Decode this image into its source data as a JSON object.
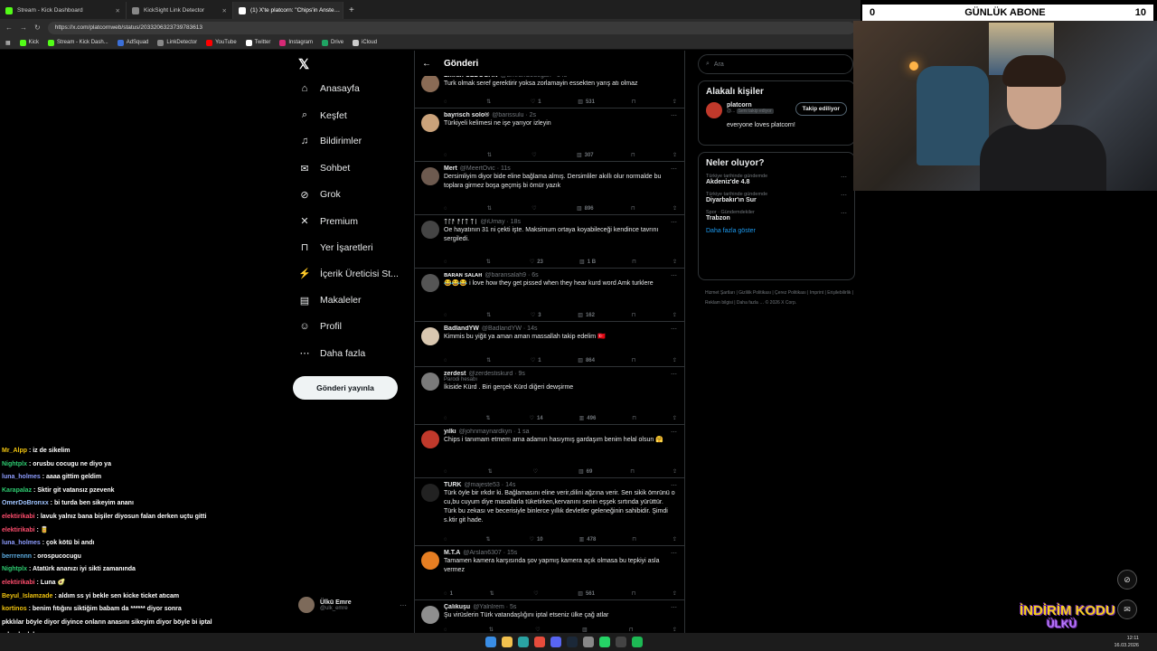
{
  "browser": {
    "tabs": [
      {
        "label": "Stream - Kick Dashboard",
        "color": "#53fc18",
        "active": false
      },
      {
        "label": "KickSight Link Detector",
        "color": "#888888",
        "active": false
      },
      {
        "label": "(1) X'te platcorn: \"Chips'in Anste…",
        "color": "#ffffff",
        "active": true
      }
    ],
    "address": "https://x.com/platcornweb/status/2033206323739783613",
    "bookmarks": [
      {
        "label": "Kick",
        "color": "#53fc18"
      },
      {
        "label": "Stream - Kick Dash...",
        "color": "#53fc18"
      },
      {
        "label": "AdSquad",
        "color": "#3b6fd8"
      },
      {
        "label": "LinkDetector",
        "color": "#888888"
      },
      {
        "label": "YouTube",
        "color": "#ff0000"
      },
      {
        "label": "Twitter",
        "color": "#ffffff"
      },
      {
        "label": "Instagram",
        "color": "#d62976"
      },
      {
        "label": "Drive",
        "color": "#1fa463"
      },
      {
        "label": "iCloud",
        "color": "#cccccc"
      }
    ]
  },
  "nav": {
    "items": [
      {
        "label": "Anasayfa",
        "icon": "home-icon",
        "glyph": "⌂"
      },
      {
        "label": "Keşfet",
        "icon": "search-icon",
        "glyph": "⌕"
      },
      {
        "label": "Bildirimler",
        "icon": "bell-icon",
        "glyph": "♫"
      },
      {
        "label": "Sohbet",
        "icon": "mail-icon",
        "glyph": "✉"
      },
      {
        "label": "Grok",
        "icon": "grok-icon",
        "glyph": "⊘"
      },
      {
        "label": "Premium",
        "icon": "x-premium-icon",
        "glyph": "✕"
      },
      {
        "label": "Yer İşaretleri",
        "icon": "bookmark-icon",
        "glyph": "⊓"
      },
      {
        "label": "İçerik Üreticisi St...",
        "icon": "bolt-icon",
        "glyph": "⚡"
      },
      {
        "label": "Makaleler",
        "icon": "article-icon",
        "glyph": "▤"
      },
      {
        "label": "Profil",
        "icon": "person-icon",
        "glyph": "☺"
      },
      {
        "label": "Daha fazla",
        "icon": "more-circle-icon",
        "glyph": "⋯"
      }
    ],
    "post_button": "Gönderi yayınla",
    "profile_name": "Ülkü Emre",
    "profile_handle": "@ulk_emre"
  },
  "timeline": {
    "title": "Gönderi",
    "tweets": [
      {
        "name": "Emran ÖZDOĞAN",
        "handle": "@EmranOzdogan · 14s",
        "text": "Turk olmak seref gerektirir yoksa zorlamayin essekten yarış atı olmaz",
        "replies": "",
        "retweets": "",
        "likes": "1",
        "views": "531",
        "avatar": "#8a6b55"
      },
      {
        "name": "bayrisch solo®",
        "handle": "@barissulu · 2s",
        "text": "Türkiyeli kelimesi ne işe yarıyor izleyin",
        "replies": "",
        "retweets": "",
        "likes": "",
        "views": "307",
        "avatar": "#caa27a"
      },
      {
        "name": "Mert",
        "handle": "@MeertOvic · 11s",
        "text": "Dersimliyim diyor bide eline bağlama almış. Dersimliler akıllı olur normalde bu toplara girmez boşa geçmiş bi ömür yazık",
        "replies": "",
        "retweets": "",
        "likes": "",
        "views": "896",
        "avatar": "#6d5a4f"
      },
      {
        "name": "ᛏᛚᚨ ᚨᛚᛏ ᛏᛁ",
        "handle": "@iUmay · 18s",
        "text": "Oe hayatının 31 ni çekti işte. Maksimum ortaya koyabileceği kendince tavrını sergiledi.",
        "replies": "",
        "retweets": "",
        "likes": "23",
        "views": "1 B",
        "avatar": "#444444"
      },
      {
        "name": "ʙᴀʀᴀɴ sᴀʟᴀʜ",
        "handle": "@baransalah9 · 6s",
        "text": "😂😂😂 i love how they get pissed when they hear kurd word Amk turklere",
        "replies": "",
        "retweets": "",
        "likes": "3",
        "views": "162",
        "avatar": "#555555"
      },
      {
        "name": "BadlandYW",
        "handle": "@BadlandYW · 14s",
        "text": "Kimmis bu yiğit ya aman aman massallah takip edelim 🇹🇷",
        "replies": "",
        "retweets": "",
        "likes": "1",
        "views": "864",
        "avatar": "#d9c7b0"
      },
      {
        "name": "zerdest",
        "handle": "@zerdestiskurd · 9s",
        "text": "İkiside Kürd . Biri gerçek Kürd diğeri dewşirme",
        "replies": "",
        "retweets": "",
        "likes": "14",
        "views": "496",
        "avatar": "#7a7a7a",
        "note": "Parodi hesabı"
      },
      {
        "name": "yılkı",
        "handle": "@johnmaynardkyn · 1 sa",
        "text": "Chips i tanımam etmem ama adamın hasıymış gardaşım benim helal olsun 🤗",
        "replies": "",
        "retweets": "",
        "likes": "",
        "views": "69",
        "avatar": "#c0392b"
      },
      {
        "name": "TÜRK",
        "handle": "@majeste53 · 14s",
        "text": "Türk öyle bir ırkdır ki. Bağlamasını eline verir,dilini ağzına verir. Sen sikik ömrünü o cu,bu cuyum diye masallarla tüketirken,kervanını senin eşşek sırtında yürüttür. Türk bu zekası ve becerisiyle binlerce yıllık devletler geleneğinin sahibidir. Şimdi s.ktir git hade.",
        "replies": "",
        "retweets": "",
        "likes": "10",
        "views": "478",
        "avatar": "#222222"
      },
      {
        "name": "M.T.A",
        "handle": "@Arslan6307 · 15s",
        "text": "Tamamen kamera karşısında şov yapmış kamera açık olmasa bu tepkiyi asla vermez",
        "replies": "1",
        "retweets": "",
        "likes": "",
        "views": "561",
        "avatar": "#e67e22"
      },
      {
        "name": "Çalıkuşu",
        "handle": "@Yalnİrem · 5s",
        "text": "Şu virüslerin Türk vatandaşlığını iptal etseniz ülke çağ atlar",
        "replies": "",
        "retweets": "",
        "likes": "",
        "views": "",
        "avatar": "#8e8e8e"
      }
    ]
  },
  "right": {
    "search_placeholder": "Ara",
    "people_title": "Alakalı kişiler",
    "person": {
      "name": "platcorn",
      "handle": "@...",
      "badge": "Seni takip ediyor",
      "bio": "everyone loves platcorn!",
      "follow_label": "Takip ediliyor"
    },
    "trends_title": "Neler oluyor?",
    "trends": [
      {
        "cat": "Türkiye tarihinde gündemde",
        "name": "Akdeniz'de 4.8"
      },
      {
        "cat": "Türkiye tarihinde gündemde",
        "name": "Diyarbakır'ın Sur"
      },
      {
        "cat": "Spor · Gündemdekiler",
        "name": "Trabzon"
      }
    ],
    "show_more": "Daha fazla göster",
    "footer": "Hizmet Şartları | Gizlilik Politikası | Çerez Politikası | Imprint | Erişilebilirlik | Reklam bilgisi | Daha fazla … © 2026 X Corp."
  },
  "chat": [
    {
      "user": "Mr_Alpp",
      "color": "#f1c40f",
      "text": "iz de sikelim"
    },
    {
      "user": "Nightplx",
      "color": "#2ecc71",
      "text": "orusbu cocugu ne diyo ya"
    },
    {
      "user": "luna_holmes",
      "color": "#8e9dff",
      "text": "aaaa gittim geldim"
    },
    {
      "user": "Karapalaz",
      "color": "#2ecc71",
      "text": "Sktir git vatansız pzevenk"
    },
    {
      "user": "OmerDoBronxx",
      "color": "#a0c4ff",
      "text": "bi turda ben sikeyim ananı"
    },
    {
      "user": "elektirikabi",
      "color": "#ff4d6d",
      "text": "lavuk yalnız bana bişiler diyosun falan derken uçtu gitti"
    },
    {
      "user": "elektirikabi",
      "color": "#ff4d6d",
      "text": "🥫"
    },
    {
      "user": "luna_holmes",
      "color": "#8e9dff",
      "text": "çok kötü bi andı"
    },
    {
      "user": "berrrennn",
      "color": "#5dade2",
      "text": "orospucocugu"
    },
    {
      "user": "Nightplx",
      "color": "#2ecc71",
      "text": "Atatürk ananızı iyi sikti zamanında"
    },
    {
      "user": "elektirikabi",
      "color": "#ff4d6d",
      "text": "Luna 🥑"
    },
    {
      "user": "Beyul_Islamzade",
      "color": "#f1c40f",
      "text": "aldım ss yi bekle sen kicke ticket atıcam"
    },
    {
      "user": "kortinos",
      "color": "#f1c40f",
      "text": "benim fıtığını siktiğim babam da ****** diyor sonra"
    },
    {
      "user": "pkk",
      "color": "#ffffff",
      "text": "lılar böyle diyor diyince onların anasını sikeyim diyor böyle bi iptal adamla dalaşıyorum"
    }
  ],
  "overlay": {
    "sub_left": "0",
    "sub_title": "GÜNLÜK ABONE",
    "sub_right": "10",
    "promo_line1": "İNDİRİM KODU",
    "promo_line2": "ÜLKÜ"
  },
  "clock": {
    "time": "12:11",
    "date": "16.03.2026"
  }
}
